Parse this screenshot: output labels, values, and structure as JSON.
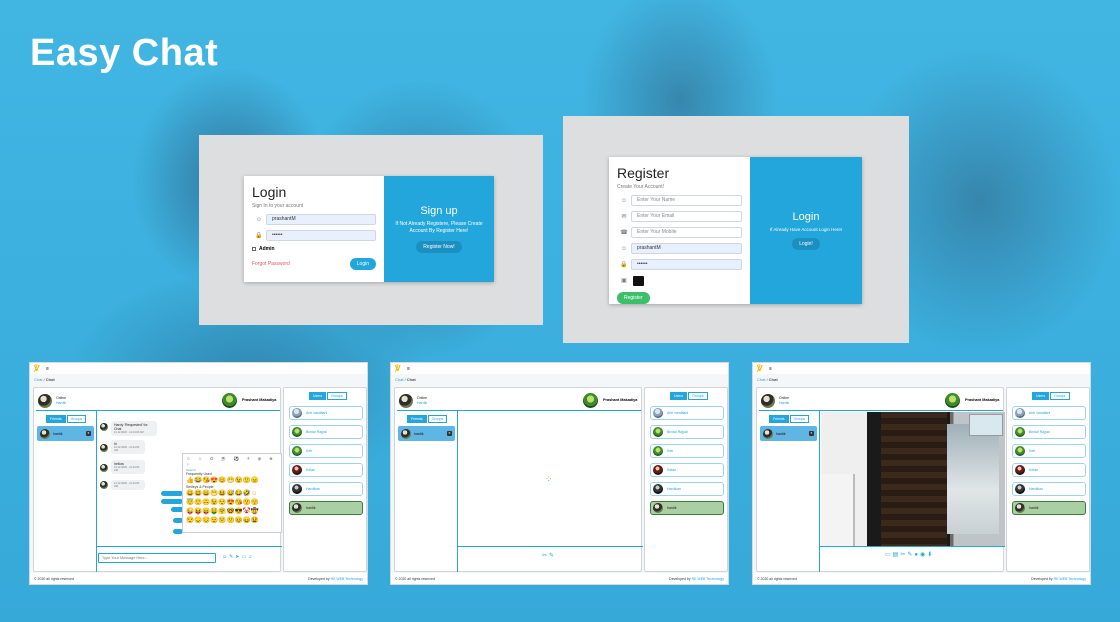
{
  "app_title": "Easy Chat",
  "login": {
    "title": "Login",
    "subtitle": "Sign In to your account",
    "username_value": "prashantM",
    "password_value": "••••••",
    "admin_label": "Admin",
    "forgot_label": "Forgot Password",
    "login_button": "Login",
    "signup_title": "Sign up",
    "signup_text": "If Not Already Registere, Please Create Account By Register Here!",
    "register_now_button": "Register Now!"
  },
  "register": {
    "title": "Register",
    "subtitle": "Create Your Account!",
    "name_placeholder": "Enter Your Name",
    "email_placeholder": "Enter Your Email",
    "mobile_placeholder": "Enter Your Mobile",
    "username_value": "prashantM",
    "password_value": "••••••",
    "register_button": "Register",
    "login_title": "Login",
    "login_text": "If Already Have Account Login Here!",
    "login_button": "Login!"
  },
  "chat": {
    "breadcrumb_root": "Chat",
    "breadcrumb_current": "Chat",
    "user_status_line1": "Online",
    "user_name": "Hardik",
    "header_contact": "Prashant Makadiya",
    "tab_friends": "Friends",
    "tab_groups": "Groups",
    "tab_users": "Users",
    "friend_name": "hardik",
    "friend_badge": "5",
    "contacts": [
      "Ahir vanditani",
      "Bindal Rajpal",
      "Keti",
      "Ketan",
      "Hardikan",
      "hardik"
    ],
    "messages": [
      {
        "text": "Hardy 'Requested' for Chat",
        "time": "12.12.2020 - 11:44:00 AM"
      },
      {
        "text": "hi",
        "time": "12.12.2020 - 11:44:00 AM"
      },
      {
        "text": "hellow",
        "time": "12.12.2020 - 11:44:00 AM"
      },
      {
        "text": "",
        "time": "12.12.2020 - 11:44:00 AM"
      }
    ],
    "emoji_search": "Search",
    "emoji_freq": "Frequently Used",
    "emoji_people": "Smileys & People",
    "input_placeholder": "Type Your Message Here...",
    "footer_left": "© 2020 all rights reserved",
    "footer_right_prefix": "Developed by",
    "footer_right_link": "RK WEB Technology"
  },
  "colors": {
    "accent": "#22a6dc",
    "selected_contact": "#a9cfa2"
  }
}
